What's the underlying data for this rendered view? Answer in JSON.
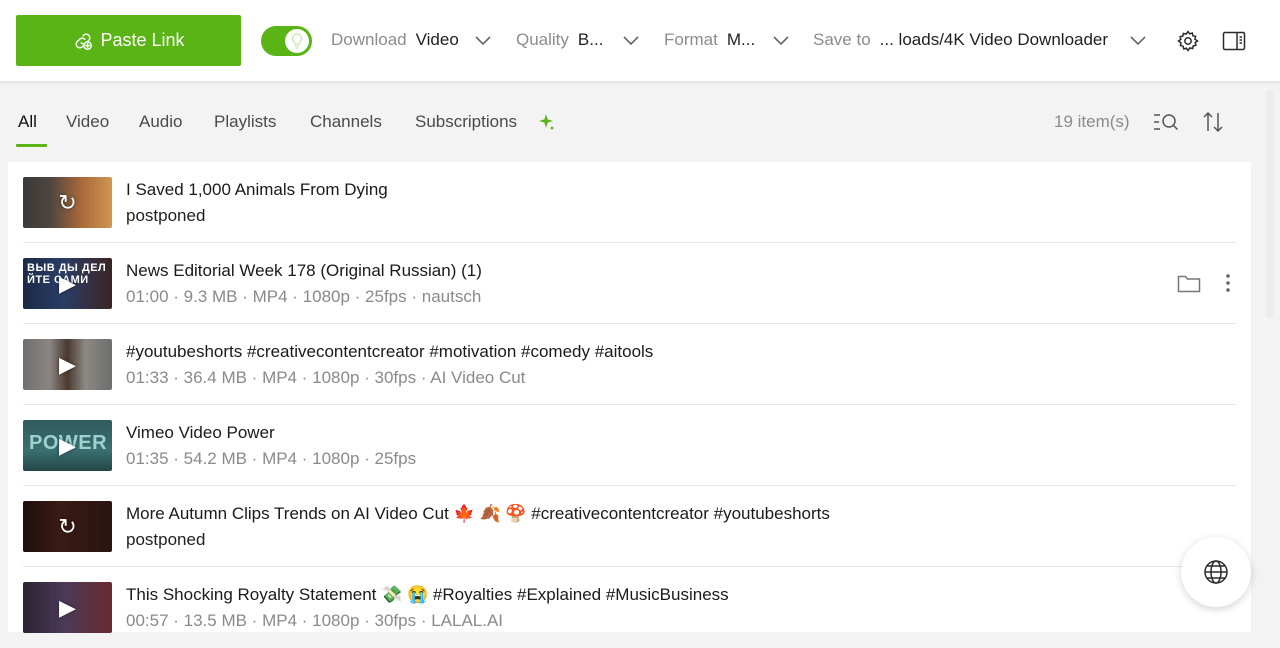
{
  "toolbar": {
    "paste_label": "Paste Link",
    "download_label": "Download",
    "download_value": "Video",
    "quality_label": "Quality",
    "quality_value": "B...",
    "format_label": "Format",
    "format_value": "M...",
    "save_label": "Save to",
    "save_value": "... loads/4K Video Downloader",
    "smart_mode_on": true,
    "accent_color": "#5ab415"
  },
  "tabs": [
    {
      "label": "All",
      "active": true
    },
    {
      "label": "Video",
      "active": false
    },
    {
      "label": "Audio",
      "active": false
    },
    {
      "label": "Playlists",
      "active": false
    },
    {
      "label": "Channels",
      "active": false
    },
    {
      "label": "Subscriptions",
      "active": false
    }
  ],
  "list_header": {
    "count": "19 item(s)"
  },
  "items": [
    {
      "title": "I Saved 1,000 Animals From Dying",
      "meta": "postponed",
      "state": "postponed",
      "thumb_overlay": "refresh-icon"
    },
    {
      "title": "News Editorial Week 178 (Original Russian) (1)",
      "meta": "01:00 · 9.3 MB · MP4 · 1080p · 25fps · nautsch",
      "state": "done",
      "thumb_overlay": "play-icon",
      "thumb_text": "ВЫВ ДЫ ДЕЛ ЙТЕ САМИ"
    },
    {
      "title": "#youtubeshorts #creativecontentcreator #motivation #comedy #aitools",
      "meta": "01:33 · 36.4 MB · MP4 · 1080p · 30fps · AI Video Cut",
      "state": "done",
      "thumb_overlay": "play-icon"
    },
    {
      "title": "Vimeo   Video Power",
      "meta": "01:35 · 54.2 MB · MP4 · 1080p · 25fps",
      "state": "done",
      "thumb_overlay": "play-icon",
      "thumb_text": "POWER"
    },
    {
      "title": "More Autumn Clips Trends on AI Video Cut 🍁 🍂 🍄 #creativecontentcreator #youtubeshorts",
      "meta": "postponed",
      "state": "postponed",
      "thumb_overlay": "refresh-icon"
    },
    {
      "title": "This Shocking Royalty Statement 💸 😭 #Royalties #Explained #MusicBusiness",
      "meta": "00:57 · 13.5 MB · MP4 · 1080p · 30fps · LALAL.AI",
      "state": "done",
      "thumb_overlay": "play-icon"
    }
  ]
}
